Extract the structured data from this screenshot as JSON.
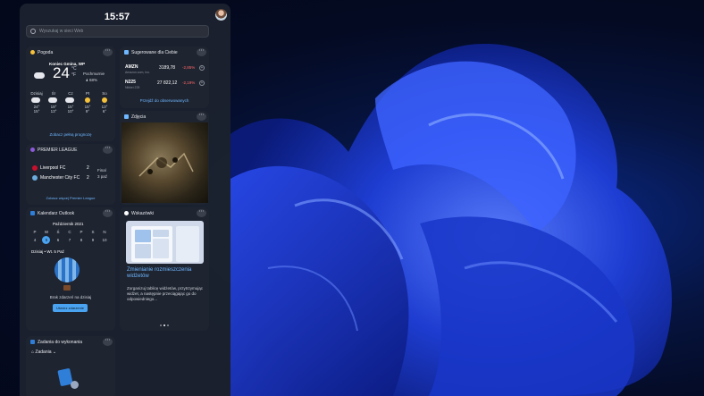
{
  "clock": "15:57",
  "search": {
    "placeholder": "Wyszukaj w sieci Web"
  },
  "weather": {
    "title": "Pogoda",
    "location": "Koniec Gmina, WP",
    "temp": "24",
    "unit_c": "°C",
    "unit_f": "°F",
    "condition": "Pochmurnie",
    "humidity": "🌢 68%",
    "forecast": [
      {
        "day": "Dzisiaj",
        "hi": "24°",
        "lo": "15°"
      },
      {
        "day": "Śr",
        "hi": "19°",
        "lo": "13°"
      },
      {
        "day": "Cz",
        "hi": "15°",
        "lo": "10°"
      },
      {
        "day": "Pt",
        "hi": "15°",
        "lo": "9°"
      },
      {
        "day": "So",
        "hi": "13°",
        "lo": "6°"
      }
    ],
    "link": "Zobacz pełną prognozę"
  },
  "stocks": {
    "title": "Sugerowane dla Ciebie",
    "items": [
      {
        "sym": "AMZN",
        "sub": "Amazon.com, Inc.",
        "val": "3189,78",
        "chg": "-2,85%"
      },
      {
        "sym": "N225",
        "sub": "Nikkei 225",
        "val": "27 822,12",
        "chg": "-2,19%"
      }
    ],
    "link": "Przejdź do obserwowanych"
  },
  "photos": {
    "title": "Zdjęcia"
  },
  "sports": {
    "title": "PREMIER LEAGUE",
    "teams": [
      {
        "name": "Liverpool FC",
        "score": "2"
      },
      {
        "name": "Manchester City FC",
        "score": "2"
      }
    ],
    "status": "Final",
    "date": "3 paź",
    "link": "Zobacz więcej Premier League"
  },
  "calendar": {
    "title": "Kalendarz Outlook",
    "month": "Październik 2021",
    "weekdays": [
      "P",
      "W",
      "Ś",
      "C",
      "P",
      "S",
      "N"
    ],
    "days": [
      "4",
      "5",
      "6",
      "7",
      "8",
      "9",
      "10"
    ],
    "today_label": "Dzisiaj • Wt. 5 Paź",
    "empty": "Brak zdarzeń na dzisiaj",
    "button": "Utwórz zdarzenie"
  },
  "tips": {
    "title": "Wskazówki",
    "headline": "Zmienianie rozmieszczenia widżetów",
    "body": "Zorganizuj tablicę widżetów, przytrzymując widżet, a następnie przeciągając go do odpowiedniego..."
  },
  "todo": {
    "title": "Zadania do wykonania",
    "list": "Zadania"
  },
  "colors": {
    "accent": "#4aa3f0",
    "panel": "#1c222e",
    "negative": "#ff6a6a"
  }
}
